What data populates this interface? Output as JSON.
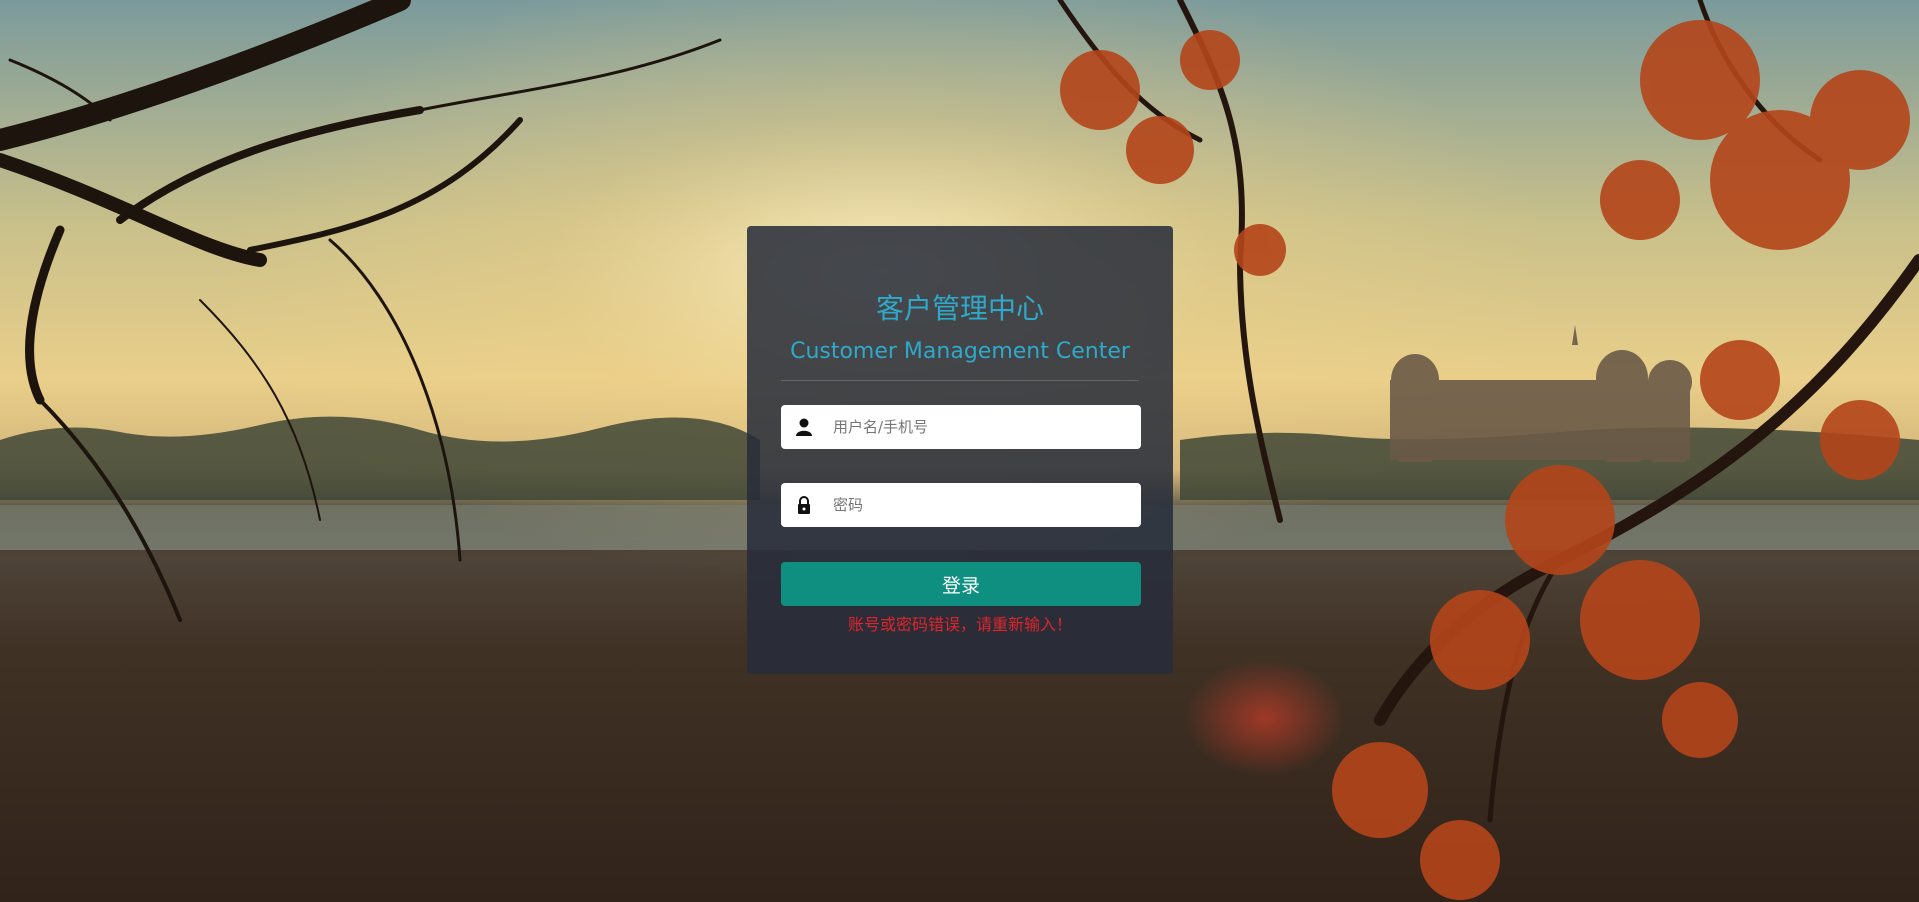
{
  "header": {
    "title_cn": "客户管理中心",
    "title_en": "Customer Management Center"
  },
  "form": {
    "username_placeholder": "用户名/手机号",
    "username_value": "",
    "password_placeholder": "密码",
    "password_value": "",
    "login_label": "登录",
    "error_message": "账号或密码错误，请重新输入！"
  },
  "icons": {
    "username": "user-icon",
    "password": "lock-icon"
  },
  "colors": {
    "accent": "#2fa9c9",
    "button": "#0e8f7f",
    "error": "#e0242a",
    "panel": "#262c3a"
  }
}
